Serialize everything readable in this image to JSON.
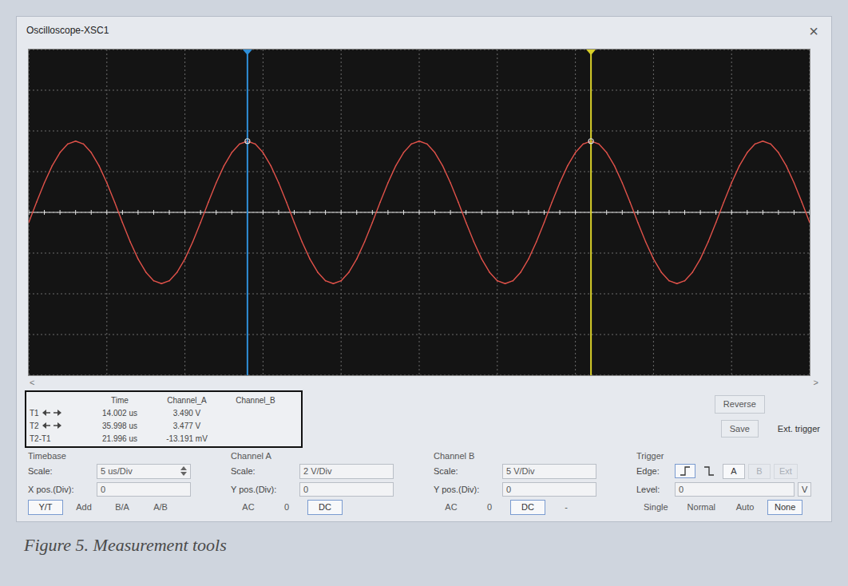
{
  "window": {
    "title": "Oscilloscope-XSC1",
    "close": "×"
  },
  "display": {
    "x_range_us": [
      0,
      50
    ],
    "y_range_v": [
      -8,
      8
    ],
    "divisions_x": 10,
    "divisions_y": 8,
    "series": [
      {
        "name": "Channel_A",
        "color": "#e0524a",
        "time_step_us": 0.5,
        "values": [
          -0.5,
          0.5,
          1.45,
          2.29,
          2.94,
          3.36,
          3.5,
          3.36,
          2.94,
          2.29,
          1.45,
          0.5,
          -0.5,
          -1.45,
          -2.29,
          -2.94,
          -3.36,
          -3.5,
          -3.36,
          -2.94,
          -2.29,
          -1.45,
          -0.5,
          0.5,
          1.45,
          2.29,
          2.94,
          3.36,
          3.5,
          3.36,
          2.94,
          2.29,
          1.45,
          0.5,
          -0.5,
          -1.45,
          -2.29,
          -2.94,
          -3.36,
          -3.5,
          -3.36,
          -2.94,
          -2.29,
          -1.45,
          -0.5,
          0.5,
          1.45,
          2.29,
          2.94,
          3.36,
          3.5,
          3.36,
          2.94,
          2.29,
          1.45,
          0.5,
          -0.5,
          -1.45,
          -2.29,
          -2.94,
          -3.36,
          -3.5,
          -3.36,
          -2.94,
          -2.29,
          -1.45,
          -0.5,
          0.5,
          1.45,
          2.29,
          2.94,
          3.36,
          3.5,
          3.36,
          2.94,
          2.29,
          1.45,
          0.5,
          -0.5,
          -1.45,
          -2.29,
          -2.94,
          -3.36,
          -3.5,
          -3.36,
          -2.94,
          -2.29,
          -1.45,
          -0.5,
          0.5,
          1.45,
          2.29,
          2.94,
          3.36,
          3.5,
          3.36,
          2.94,
          2.29,
          1.45,
          0.5,
          -0.5
        ]
      }
    ],
    "cursors": [
      {
        "label": "T1",
        "x_us": 14.002,
        "color": "#2f8fd8"
      },
      {
        "label": "T2",
        "x_us": 35.998,
        "color": "#d9d02a"
      }
    ]
  },
  "scroll": {
    "left": "<",
    "right": ">"
  },
  "readout": {
    "columns": [
      "Time",
      "Channel_A",
      "Channel_B"
    ],
    "rows": [
      {
        "label": "T1",
        "arrows": true,
        "time": "14.002 us",
        "channel_a": "3.490 V"
      },
      {
        "label": "T2",
        "arrows": true,
        "time": "35.998 us",
        "channel_a": "3.477 V"
      },
      {
        "label": "T2-T1",
        "arrows": false,
        "time": "21.996 us",
        "channel_a": "-13.191 mV"
      }
    ]
  },
  "side_buttons": [
    {
      "label": "Reverse"
    },
    {
      "label": "Save"
    }
  ],
  "ext_trigger": "Ext. trigger",
  "timebase": {
    "title": "Timebase",
    "scale_label": "Scale:",
    "scale": "5 us/Div",
    "pos_label": "X pos.(Div):",
    "pos": "0",
    "modes": [
      {
        "label": "Y/T",
        "selected": true
      },
      {
        "label": "Add",
        "selected": false
      },
      {
        "label": "B/A",
        "selected": false
      },
      {
        "label": "A/B",
        "selected": false
      }
    ]
  },
  "channel_a": {
    "title": "Channel A",
    "scale_label": "Scale:",
    "scale": "2 V/Div",
    "pos_label": "Y pos.(Div):",
    "pos": "0",
    "modes": [
      {
        "label": "AC",
        "selected": false
      },
      {
        "label": "0",
        "selected": false
      },
      {
        "label": "DC",
        "selected": true
      }
    ]
  },
  "channel_b": {
    "title": "Channel B",
    "scale_label": "Scale:",
    "scale": "5 V/Div",
    "pos_label": "Y pos.(Div):",
    "pos": "0",
    "modes": [
      {
        "label": "AC",
        "selected": false
      },
      {
        "label": "0",
        "selected": false
      },
      {
        "label": "DC",
        "selected": true
      },
      {
        "label": "-",
        "selected": false
      }
    ]
  },
  "trigger": {
    "title": "Trigger",
    "edge_label": "Edge:",
    "edges": [
      {
        "kind": "rising",
        "selected": true
      },
      {
        "kind": "falling",
        "selected": false
      }
    ],
    "sources": [
      {
        "label": "A",
        "disabled": false
      },
      {
        "label": "B",
        "disabled": true
      },
      {
        "label": "Ext",
        "disabled": true
      }
    ],
    "level_label": "Level:",
    "level": "0",
    "level_unit": "V",
    "modes": [
      {
        "label": "Single",
        "selected": false
      },
      {
        "label": "Normal",
        "selected": false
      },
      {
        "label": "Auto",
        "selected": false
      },
      {
        "label": "None",
        "selected": true
      }
    ]
  },
  "caption": "Figure 5. Measurement tools"
}
